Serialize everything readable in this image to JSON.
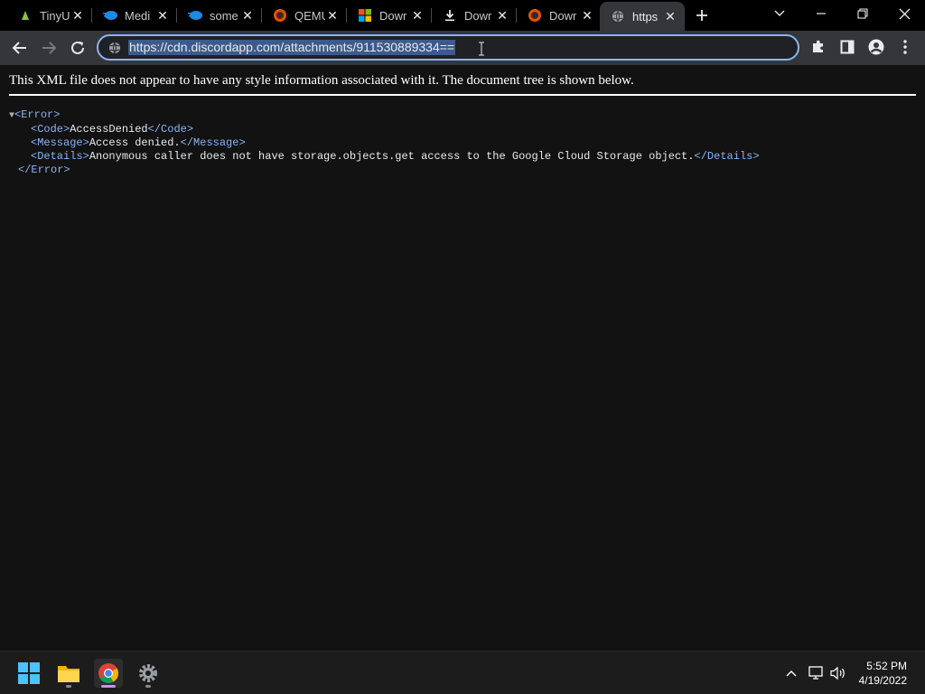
{
  "tabs": [
    {
      "title": "TinyU",
      "icon": "tinyurl-icon"
    },
    {
      "title": "Medi",
      "icon": "mediafire-icon"
    },
    {
      "title": "some",
      "icon": "mediafire-icon"
    },
    {
      "title": "QEMU",
      "icon": "qemu-icon"
    },
    {
      "title": "Dowr",
      "icon": "microsoft-icon"
    },
    {
      "title": "Dowr",
      "icon": "download-icon"
    },
    {
      "title": "Dowr",
      "icon": "qemu-icon"
    },
    {
      "title": "https",
      "icon": "globe-icon",
      "active": true
    }
  ],
  "omnibox": {
    "url": "https://cdn.discordapp.com/attachments/911530889334=="
  },
  "page": {
    "notice": "This XML file does not appear to have any style information associated with it. The document tree is shown below.",
    "xml": {
      "open_error": "<Error>",
      "code_open": "<Code>",
      "code_value": "AccessDenied",
      "code_close": "</Code>",
      "message_open": "<Message>",
      "message_value": "Access denied.",
      "message_close": "</Message>",
      "details_open": "<Details>",
      "details_value": "Anonymous caller does not have storage.objects.get access to the Google Cloud Storage object.",
      "details_close": "</Details>",
      "close_error": "</Error>"
    }
  },
  "taskbar": {
    "time": "5:52 PM",
    "date": "4/19/2022"
  },
  "colors": {
    "accent": "#8ab4f8",
    "xml_tag": "#8ab4f8",
    "url_selection": "#3c5a8c"
  }
}
